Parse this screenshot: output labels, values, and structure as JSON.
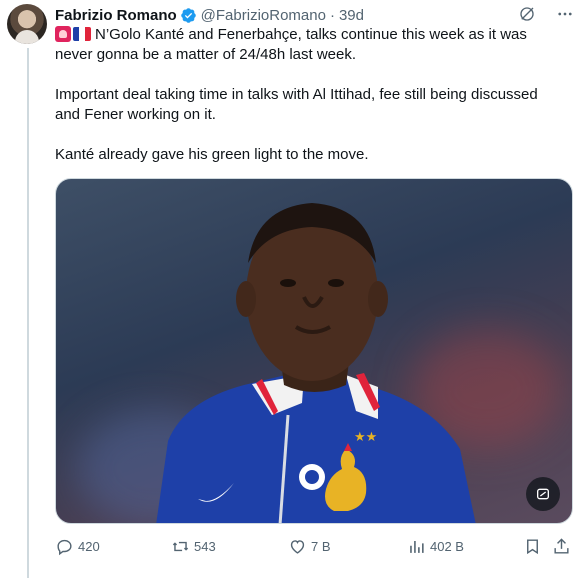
{
  "author": {
    "name": "Fabrizio Romano",
    "handle": "@FabrizioRomano",
    "separator": "·",
    "time": "39d",
    "verified_color": "#1d9bf0"
  },
  "tweet": {
    "paragraphs": [
      "N’Golo Kanté and Fenerbahçe, talks continue this week as it was never gonna be a matter of 24/48h last week.",
      "Important deal taking time in talks with Al Ittihad, fee still being discussed and Fener working on it.",
      "Kanté already gave his green light to the move."
    ],
    "emoji": [
      "alarm-emoji",
      "france-flag-emoji"
    ]
  },
  "media": {
    "subject": "player-photo",
    "button_icon": "media-edit-icon"
  },
  "actions": {
    "replies": "420",
    "reposts": "543",
    "likes": "7 B",
    "views": "402 B"
  },
  "colors": {
    "text": "#0f1419",
    "secondary": "#536471",
    "border": "#cfd9de",
    "accent": "#1d9bf0",
    "france_blue": "#1e40a8",
    "france_red": "#e0243b",
    "rooster_gold": "#e8b325"
  }
}
